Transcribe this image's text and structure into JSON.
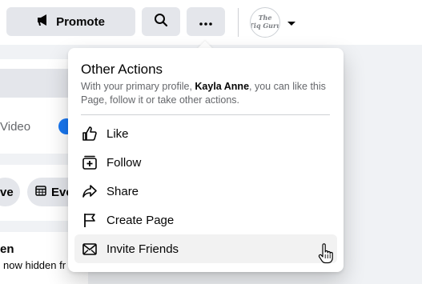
{
  "topbar": {
    "promote_label": "Promote",
    "profile_avatar_text": "The Tiq Guru"
  },
  "background": {
    "video_label": "Video",
    "pill_1_label": "ve",
    "pill_2_label": "Eve",
    "fragment_title": "en",
    "fragment_subtitle": "now hidden fr"
  },
  "menu": {
    "title": "Other Actions",
    "desc_prefix": "With your primary profile, ",
    "desc_name": "Kayla Anne",
    "desc_suffix": ", you can like this Page, follow it or take other actions.",
    "items": [
      {
        "label": "Like",
        "icon": "thumbs-up-icon"
      },
      {
        "label": "Follow",
        "icon": "follow-icon"
      },
      {
        "label": "Share",
        "icon": "share-icon"
      },
      {
        "label": "Create Page",
        "icon": "flag-icon"
      },
      {
        "label": "Invite Friends",
        "icon": "invite-icon"
      }
    ]
  },
  "colors": {
    "page_bg": "#f0f2f5",
    "button_bg": "#e4e6eb",
    "accent": "#1877f2",
    "secondary_text": "#65676b"
  }
}
